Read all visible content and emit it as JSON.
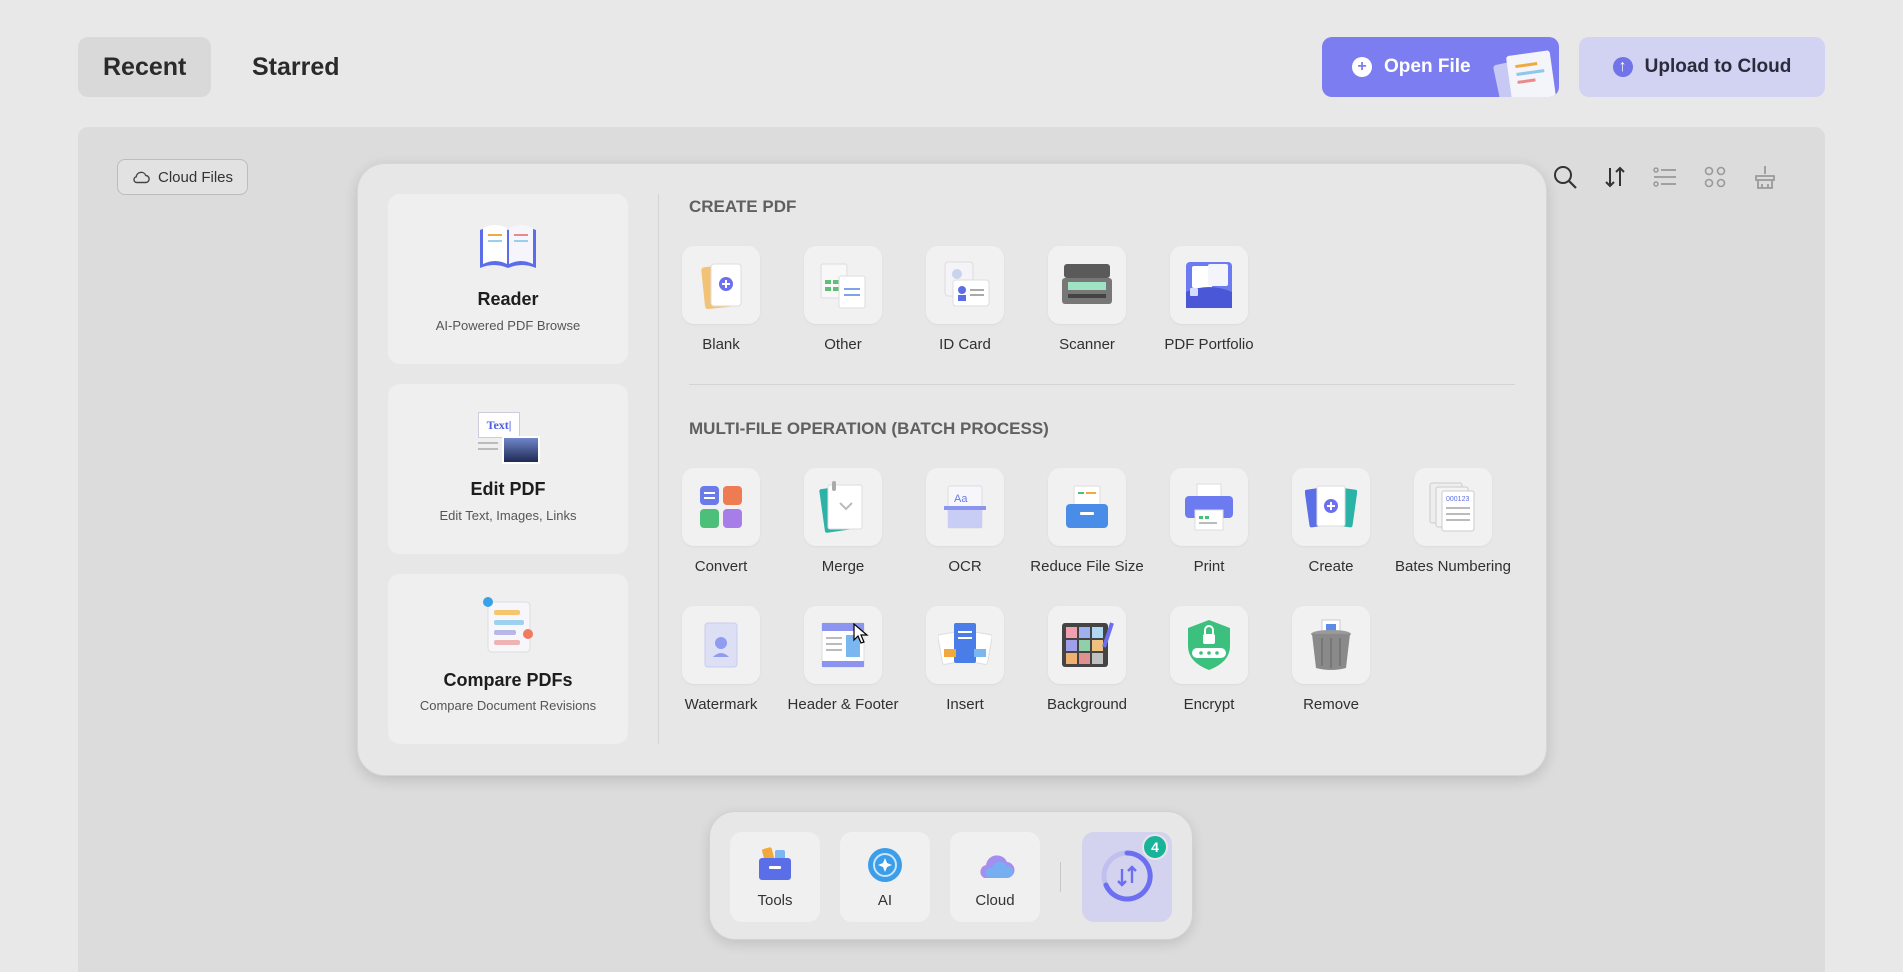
{
  "tabs": {
    "recent": "Recent",
    "starred": "Starred"
  },
  "actions": {
    "open_file": "Open File",
    "upload_to_cloud": "Upload to Cloud"
  },
  "files_panel": {
    "cloud_files_label": "Cloud Files",
    "toolbar_icons": [
      "search-icon",
      "sort-icon",
      "list-view-icon",
      "grid-view-icon",
      "clean-icon"
    ]
  },
  "tools_popup": {
    "features": [
      {
        "title": "Reader",
        "subtitle": "AI-Powered PDF Browse"
      },
      {
        "title": "Edit PDF",
        "subtitle": "Edit Text, Images, Links"
      },
      {
        "title": "Compare PDFs",
        "subtitle": "Compare Document Revisions"
      }
    ],
    "create_section": {
      "title": "CREATE PDF",
      "items": [
        "Blank",
        "Other",
        "ID Card",
        "Scanner",
        "PDF Portfolio"
      ]
    },
    "batch_section": {
      "title": "MULTI-FILE OPERATION (BATCH PROCESS)",
      "row1": [
        "Convert",
        "Merge",
        "OCR",
        "Reduce File Size",
        "Print",
        "Create",
        "Bates Numbering"
      ],
      "row2": [
        "Watermark",
        "Header & Footer",
        "Insert",
        "Background",
        "Encrypt",
        "Remove"
      ]
    },
    "edit_icon_text": "Text|"
  },
  "dock": {
    "tools": "Tools",
    "ai": "AI",
    "cloud": "Cloud",
    "convert_badge": "4"
  },
  "colors": {
    "accent": "#7d7df2",
    "accent_light": "#d2d2f2",
    "badge": "#19b39a"
  }
}
